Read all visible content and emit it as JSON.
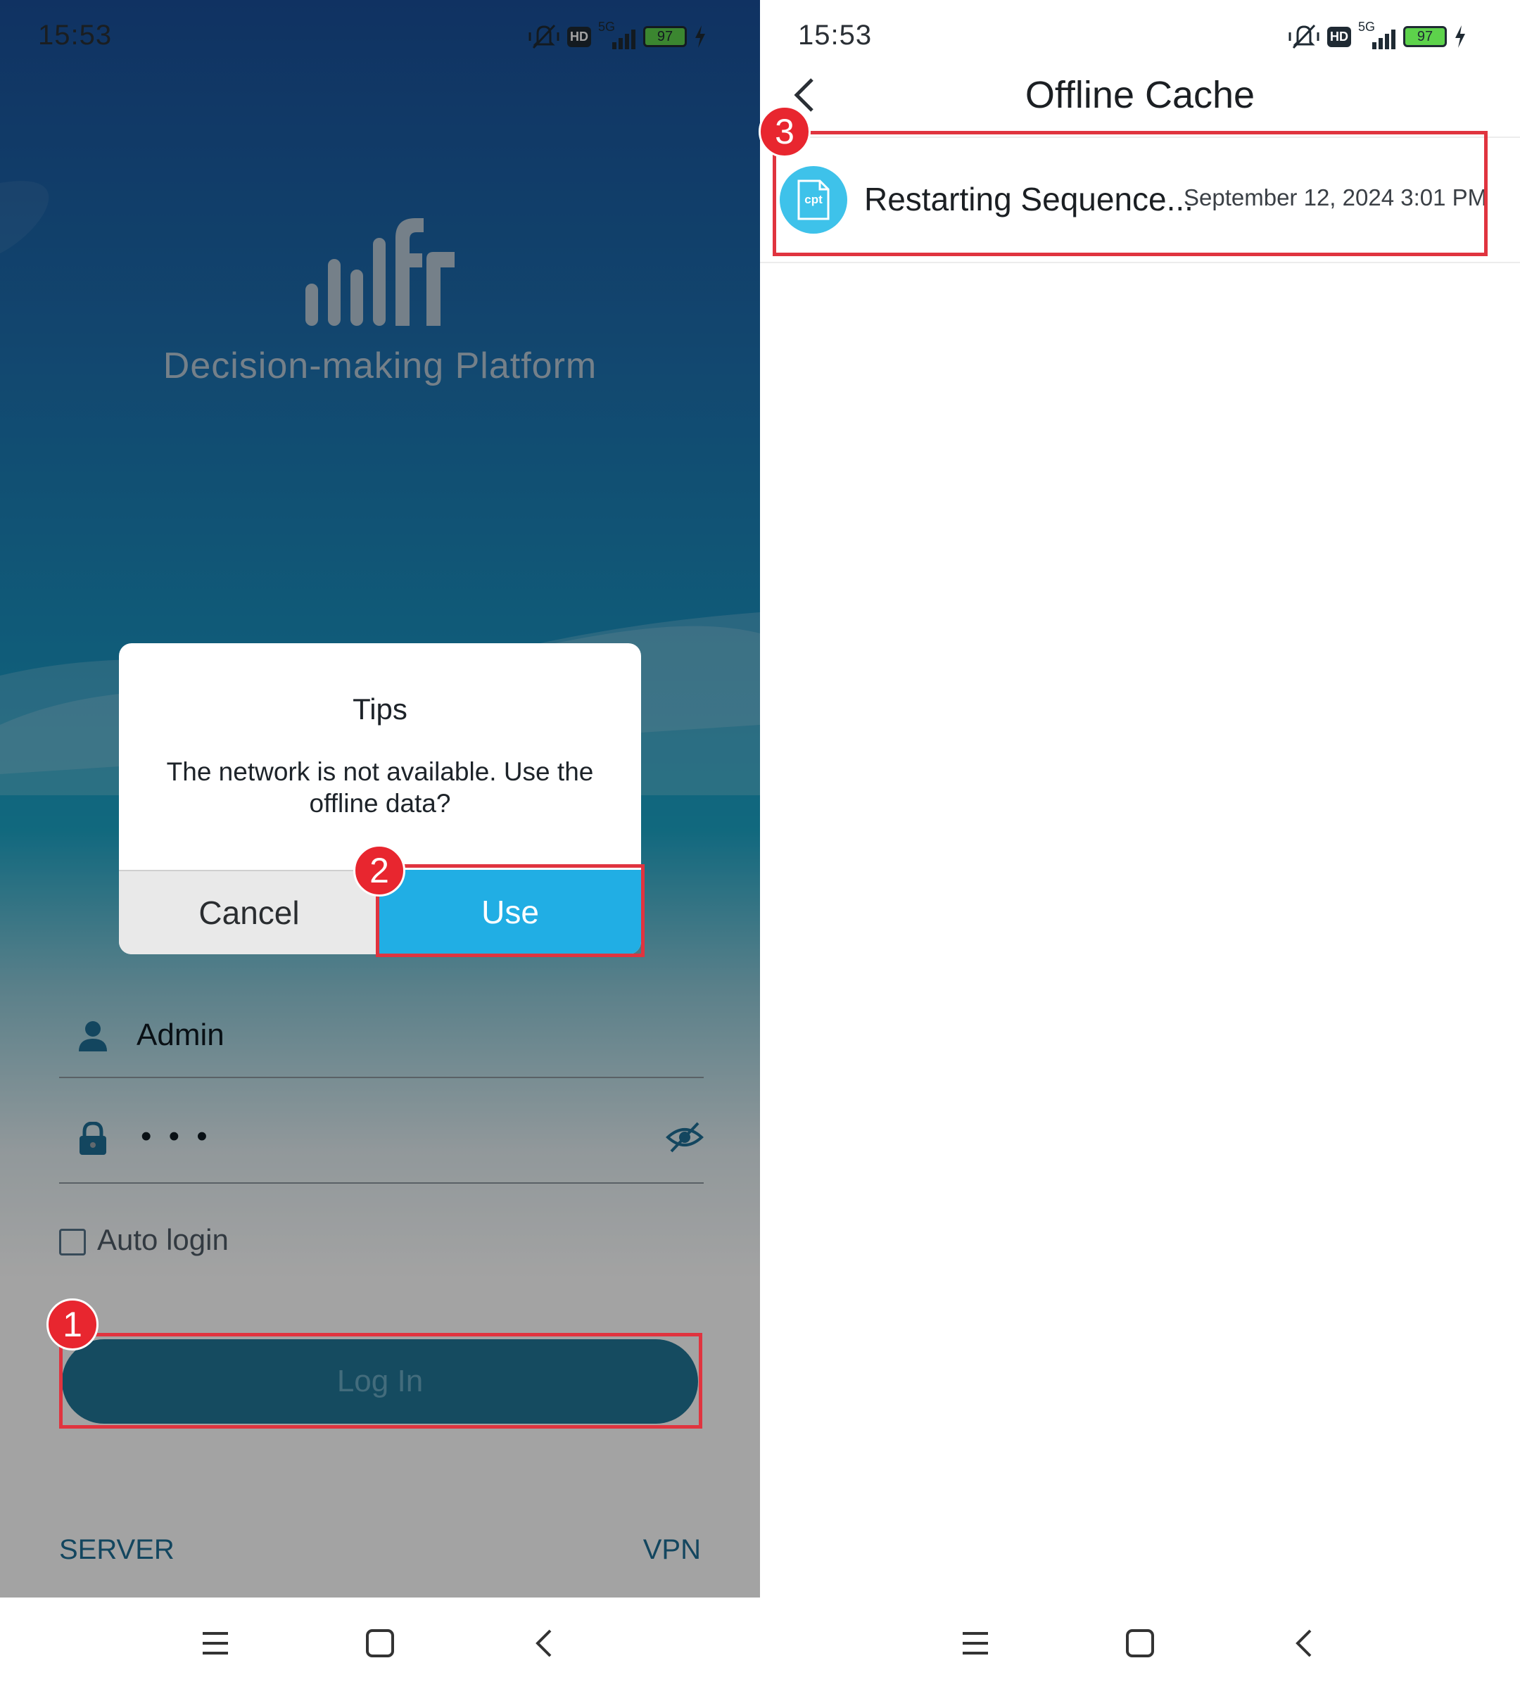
{
  "left_screen": {
    "status_bar": {
      "time": "15:53",
      "battery": "97",
      "network": "5G",
      "hd": "HD"
    },
    "app_subtitle": "Decision-making Platform",
    "dialog": {
      "title": "Tips",
      "message": "The network is not available. Use the offline data?",
      "cancel_label": "Cancel",
      "use_label": "Use"
    },
    "username": "Admin",
    "password_mask": "• • •",
    "auto_login_label": "Auto login",
    "auto_login_checked": false,
    "login_label": "Log In",
    "server_link": "SERVER",
    "vpn_link": "VPN"
  },
  "right_screen": {
    "status_bar": {
      "time": "15:53",
      "battery": "97",
      "network": "5G",
      "hd": "HD"
    },
    "page_title": "Offline Cache",
    "items": [
      {
        "icon_label": "cpt",
        "name": "Restarting Sequence...",
        "date": "September 12, 2024 3:01 PM"
      }
    ]
  },
  "annotations": [
    {
      "number": "1",
      "target": "log-in-button"
    },
    {
      "number": "2",
      "target": "use-button"
    },
    {
      "number": "3",
      "target": "cache-list-item"
    }
  ],
  "colors": {
    "accent_blue": "#21aee4",
    "login_button": "#227697",
    "highlight_red": "#e0343f",
    "file_icon": "#3ec2ea"
  },
  "icons": [
    "vibrate-mute-icon",
    "hd-icon",
    "signal-icon",
    "battery-icon",
    "charging-icon",
    "user-icon",
    "lock-icon",
    "eye-off-icon",
    "menu-icon",
    "home-icon",
    "back-icon",
    "cpt-file-icon"
  ]
}
